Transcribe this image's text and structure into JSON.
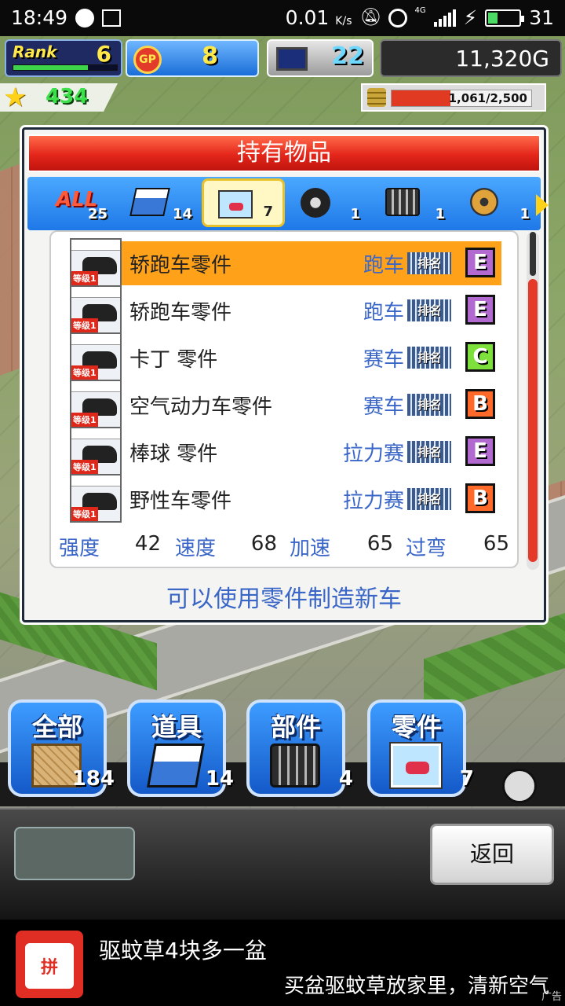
{
  "status_bar": {
    "time": "18:49",
    "net_speed": "0.01",
    "net_unit": "K/s",
    "network": "4G",
    "battery_level": "31"
  },
  "hud": {
    "rank_label": "Rank",
    "rank_value": "6",
    "rank_progress": 0.72,
    "gp_label": "GP",
    "gp_value": "8",
    "pc_value": "22",
    "money": "11,320G",
    "stars": "434",
    "capacity": "1,061/2,500",
    "capacity_fraction": 0.42
  },
  "dialog": {
    "title": "持有物品",
    "categories": [
      {
        "name": "ALL",
        "count": "25"
      },
      {
        "name": "items",
        "count": "14"
      },
      {
        "name": "parts-cards",
        "count": "7"
      },
      {
        "name": "tire",
        "count": "1"
      },
      {
        "name": "engine",
        "count": "1"
      },
      {
        "name": "gear",
        "count": "1"
      }
    ],
    "rows": [
      {
        "name": "轿跑车零件",
        "type": "跑车",
        "rank": "排名",
        "grade": "E",
        "level": "等级1"
      },
      {
        "name": "轿跑车零件",
        "type": "跑车",
        "rank": "排名",
        "grade": "E",
        "level": "等级1"
      },
      {
        "name": "卡丁 零件",
        "type": "赛车",
        "rank": "排名",
        "grade": "C",
        "level": "等级1"
      },
      {
        "name": "空气动力车零件",
        "type": "赛车",
        "rank": "排名",
        "grade": "B",
        "level": "等级1"
      },
      {
        "name": "棒球 零件",
        "type": "拉力赛",
        "rank": "排名",
        "grade": "E",
        "level": "等级1"
      },
      {
        "name": "野性车零件",
        "type": "拉力赛",
        "rank": "排名",
        "grade": "B",
        "level": "等级1"
      }
    ],
    "stats": [
      {
        "label": "强度",
        "value": "42"
      },
      {
        "label": "速度",
        "value": "68"
      },
      {
        "label": "加速",
        "value": "65"
      },
      {
        "label": "过弯",
        "value": "65"
      }
    ],
    "footer": "可以使用零件制造新车"
  },
  "menu": [
    {
      "label": "全部",
      "count": "184"
    },
    {
      "label": "道具",
      "count": "14"
    },
    {
      "label": "部件",
      "count": "4"
    },
    {
      "label": "零件",
      "count": "7"
    }
  ],
  "back_label": "返回",
  "ad": {
    "logo_text": "拼",
    "title": "驱蚊草4块多一盆",
    "desc": "买盆驱蚊草放家里，清新空气",
    "tag": "广告"
  },
  "colors": {
    "title_red": "#e4261a",
    "tab_blue": "#1e78e8",
    "selected_row": "#ffa21a",
    "link_blue": "#3a66c8"
  }
}
